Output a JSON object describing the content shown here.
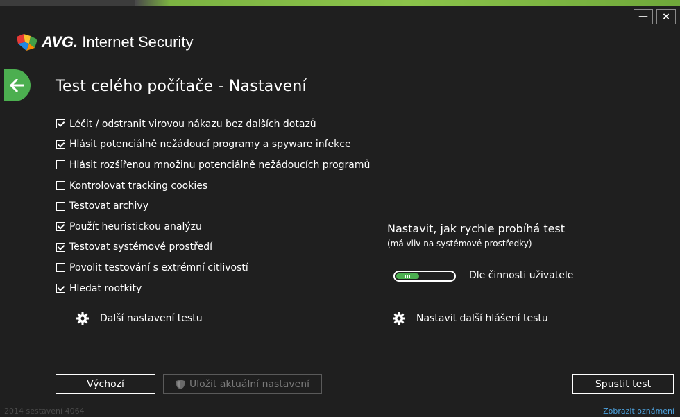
{
  "app": {
    "brand": "AVG.",
    "product": " Internet Security",
    "minimize_label": "—",
    "close_label": "×"
  },
  "page": {
    "title": "Test celého počítače - Nastavení"
  },
  "options": [
    {
      "label": "Léčit / odstranit virovou nákazu bez dalších dotazů",
      "checked": true
    },
    {
      "label": "Hlásit potenciálně nežádoucí programy a spyware infekce",
      "checked": true
    },
    {
      "label": "Hlásit rozšířenou množinu potenciálně nežádoucích programů",
      "checked": false
    },
    {
      "label": "Kontrolovat tracking cookies",
      "checked": false
    },
    {
      "label": "Testovat archivy",
      "checked": false
    },
    {
      "label": "Použít heuristickou analýzu",
      "checked": true
    },
    {
      "label": "Testovat systémové prostředí",
      "checked": true
    },
    {
      "label": "Povolit testování s extrémní citlivostí",
      "checked": false
    },
    {
      "label": "Hledat rootkity",
      "checked": true
    }
  ],
  "links": {
    "more_settings": "Další nastavení testu",
    "more_reports": "Nastavit další hlášení testu"
  },
  "speed": {
    "title": "Nastavit, jak rychle probíhá test",
    "subtitle": "(má vliv na systémové prostředky)",
    "value_label": "Dle činnosti uživatele",
    "level": 0.4
  },
  "buttons": {
    "default": "Výchozí",
    "save": "Uložit aktuální nastavení",
    "run": "Spustit test"
  },
  "footer": {
    "build": "2014  sestavení 4064",
    "notifications": "Zobrazit oznámení"
  },
  "colors": {
    "accent_green": "#4caf50",
    "background": "#1f1f1f",
    "link_blue": "#4ea3e0"
  }
}
